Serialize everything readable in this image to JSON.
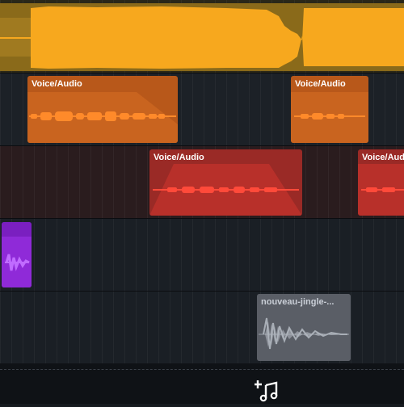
{
  "tracks": {
    "voice_clip_1": {
      "label": "Voice/Audio"
    },
    "voice_clip_2": {
      "label": "Voice/Audio"
    },
    "voice_clip_3": {
      "label": "Voice/Audio"
    },
    "voice_clip_4": {
      "label": "Voice/Audio"
    },
    "jingle_clip": {
      "label": "nouveau-jingle-..."
    }
  },
  "toolbar": {
    "add_music_icon": "music-add-icon"
  },
  "colors": {
    "music_track": "#f5a623",
    "voice_orange": "#c9601c",
    "voice_red": "#b8302a",
    "purple_clip": "#7a1fc0",
    "jingle_clip": "#5a5e66"
  }
}
